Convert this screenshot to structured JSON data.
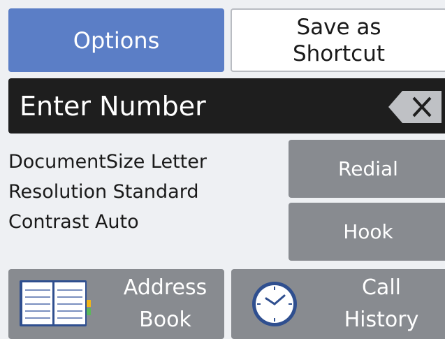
{
  "top": {
    "options_label": "Options",
    "shortcut_line1": "Save as",
    "shortcut_line2": "Shortcut"
  },
  "number_bar": {
    "placeholder": "Enter Number",
    "backspace_icon": "backspace-icon"
  },
  "settings": [
    "DocumentSize Letter",
    "Resolution Standard",
    "Contrast Auto"
  ],
  "side_buttons": {
    "redial": "Redial",
    "hook": "Hook"
  },
  "bottom": {
    "address_line1": "Address",
    "address_line2": "Book",
    "address_icon": "address-book-icon",
    "history_line1": "Call",
    "history_line2": "History",
    "history_icon": "clock-icon"
  },
  "colors": {
    "options_bg": "#5b7ec6",
    "gray_button": "#888b90",
    "number_bar_bg": "#1e1e1e",
    "screen_bg": "#eef0f3"
  }
}
